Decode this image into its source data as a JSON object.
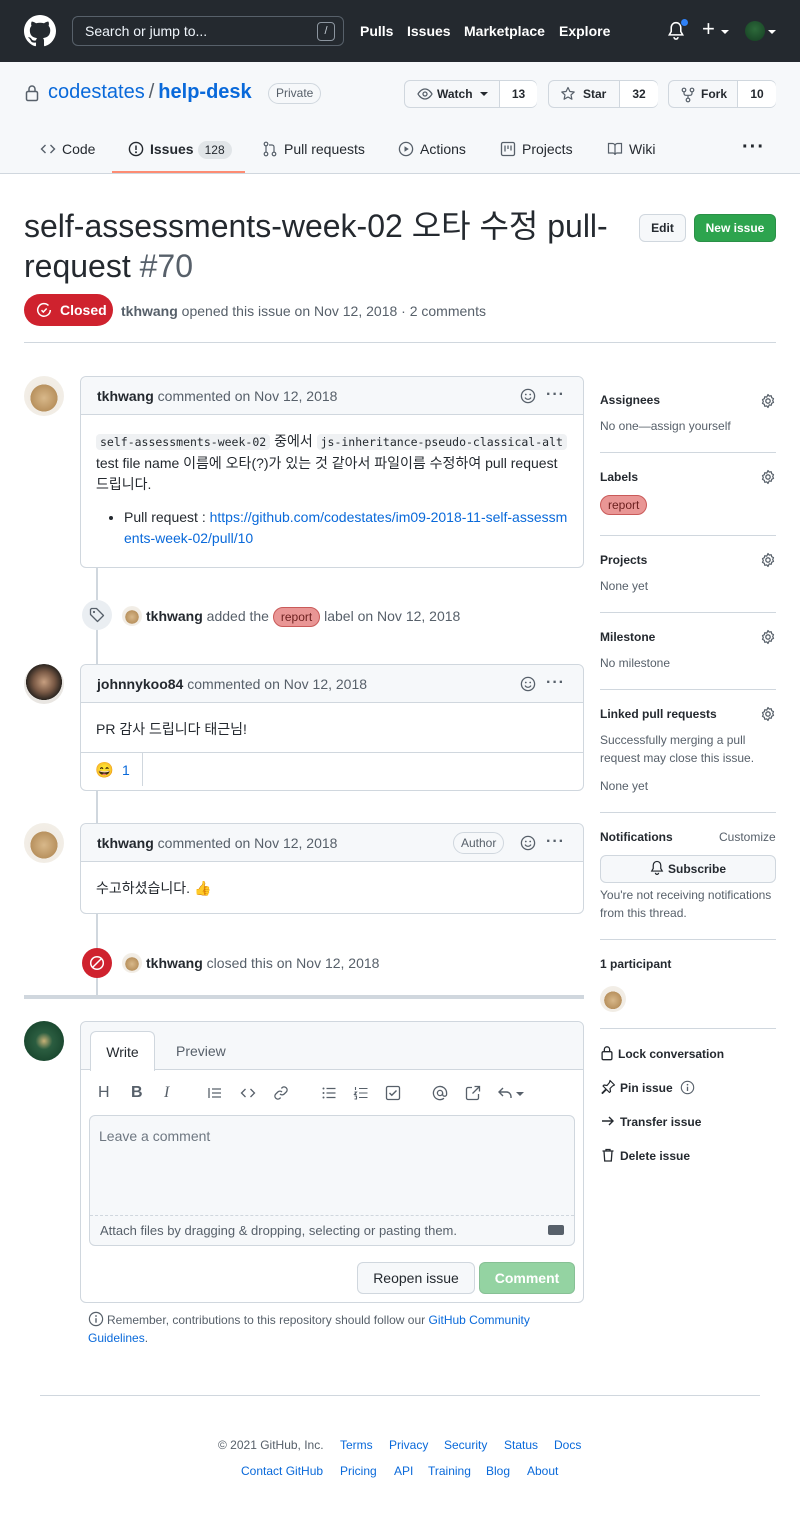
{
  "header": {
    "search_placeholder": "Search or jump to...",
    "search_key": "/",
    "nav": [
      "Pulls",
      "Issues",
      "Marketplace",
      "Explore"
    ]
  },
  "repo": {
    "owner": "codestates",
    "separator": "/",
    "name": "help-desk",
    "visibility": "Private",
    "watch_label": "Watch",
    "watch_count": "13",
    "star_label": "Star",
    "star_count": "32",
    "fork_label": "Fork",
    "fork_count": "10",
    "tabs": [
      {
        "label": "Code"
      },
      {
        "label": "Issues",
        "count": "128"
      },
      {
        "label": "Pull requests"
      },
      {
        "label": "Actions"
      },
      {
        "label": "Projects"
      },
      {
        "label": "Wiki"
      }
    ],
    "more": "···"
  },
  "issue": {
    "title_line1": "self-assessments-week-02 오타 수정 pull-",
    "title_line2": "request",
    "number": "#70",
    "edit_label": "Edit",
    "new_issue_label": "New issue",
    "state": "Closed",
    "author": "tkhwang",
    "meta_text": "opened this issue on Nov 12, 2018 · 2 comments"
  },
  "comments": [
    {
      "author": "tkhwang",
      "action": "commented on Nov 12, 2018",
      "code1": "self-assessments-week-02",
      "text1": "중에서",
      "code2": "js-inheritance-pseudo-classical-alt",
      "text2": "test file name 이름에 오타(?)가 있는 것 같아서 파일이름 수정하여 pull request 드립니다.",
      "bullet_prefix": "Pull request :",
      "bullet_link": "https://github.com/codestates/im09-2018-11-self-assessments-week-02/pull/10"
    },
    {
      "author": "johnnykoo84",
      "action": "commented on Nov 12, 2018",
      "text": "PR 감사 드립니다 태근님!",
      "reaction_emoji": "😄",
      "reaction_count": "1"
    },
    {
      "author": "tkhwang",
      "action": "commented on Nov 12, 2018",
      "badge": "Author",
      "text": "수고하셨습니다. 👍"
    }
  ],
  "events": {
    "label_event": {
      "actor": "tkhwang",
      "pre": "added the",
      "label": "report",
      "post": "label on Nov 12, 2018"
    },
    "close_event": {
      "actor": "tkhwang",
      "text": "closed this on Nov 12, 2018"
    }
  },
  "sidebar": {
    "assignees_title": "Assignees",
    "assignees_value": "No one—assign yourself",
    "labels_title": "Labels",
    "label": "report",
    "projects_title": "Projects",
    "projects_value": "None yet",
    "milestone_title": "Milestone",
    "milestone_value": "No milestone",
    "linked_title": "Linked pull requests",
    "linked_text": "Successfully merging a pull request may close this issue.",
    "linked_value": "None yet",
    "notifications_title": "Notifications",
    "customize": "Customize",
    "subscribe": "Subscribe",
    "notif_text": "You're not receiving notifications from this thread.",
    "participants": "1 participant",
    "lock": "Lock conversation",
    "pin": "Pin issue",
    "transfer": "Transfer issue",
    "delete": "Delete issue"
  },
  "composer": {
    "write_tab": "Write",
    "preview_tab": "Preview",
    "placeholder": "Leave a comment",
    "attach": "Attach files by dragging & dropping, selecting or pasting them.",
    "reopen": "Reopen issue",
    "comment": "Comment",
    "note_prefix": "Remember, contributions to this repository should follow our",
    "note_link": "GitHub Community Guidelines",
    "note_suffix": "."
  },
  "footer": {
    "copyright": "© 2021 GitHub, Inc.",
    "row1": [
      "Terms",
      "Privacy",
      "Security",
      "Status",
      "Docs"
    ],
    "row2": [
      "Contact GitHub",
      "Pricing",
      "API",
      "Training",
      "Blog",
      "About"
    ]
  },
  "colors": {
    "header_bg": "#24292f",
    "closed_red": "#cf222e",
    "green": "#2da44e",
    "link": "#0969da",
    "label_report": "#e99695"
  }
}
